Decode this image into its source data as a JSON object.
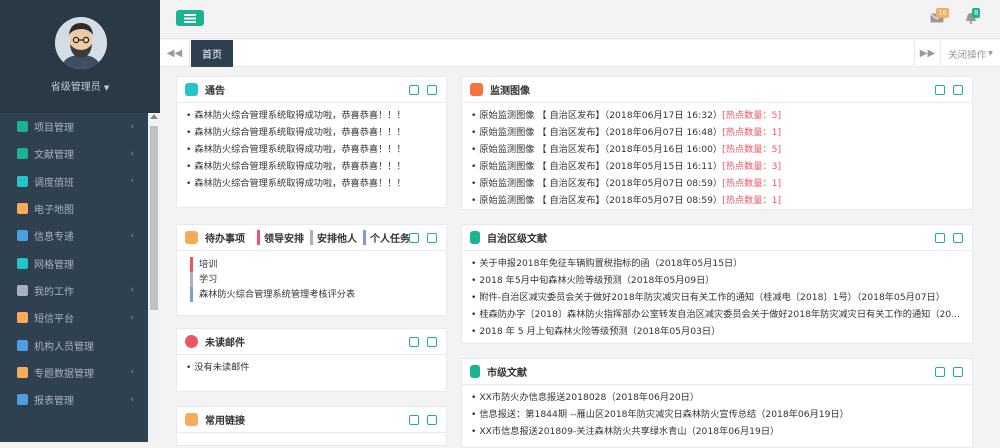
{
  "sidebar": {
    "username": "省级管理员",
    "items": [
      {
        "label": "项目管理",
        "color": "#1ab394",
        "arrow": "‹"
      },
      {
        "label": "文献管理",
        "color": "#1ab394",
        "arrow": "‹"
      },
      {
        "label": "调度值班",
        "color": "#23c6c8",
        "arrow": "‹"
      },
      {
        "label": "电子地图",
        "color": "#f8ac59",
        "arrow": ""
      },
      {
        "label": "信息专递",
        "color": "#4da0e0",
        "arrow": "‹"
      },
      {
        "label": "网格管理",
        "color": "#23c6c8",
        "arrow": ""
      },
      {
        "label": "我的工作",
        "color": "#a7b1c2",
        "arrow": "‹"
      },
      {
        "label": "短信平台",
        "color": "#f8ac59",
        "arrow": "‹"
      },
      {
        "label": "机构人员管理",
        "color": "#4da0e0",
        "arrow": ""
      },
      {
        "label": "专题数据管理",
        "color": "#f8ac59",
        "arrow": "‹"
      },
      {
        "label": "报表管理",
        "color": "#4da0e0",
        "arrow": "‹"
      }
    ]
  },
  "topbar": {
    "mail_badge": "16",
    "bell_badge": "8"
  },
  "tabs": {
    "home": "首页",
    "close_ops": "关闭操作"
  },
  "panels": {
    "notice": {
      "title": "通告",
      "items": [
        "森林防火综合管理系统取得成功啦，恭喜恭喜！！！",
        "森林防火综合管理系统取得成功啦，恭喜恭喜！！！",
        "森林防火综合管理系统取得成功啦，恭喜恭喜！！！",
        "森林防火综合管理系统取得成功啦，恭喜恭喜！！！",
        "森林防火综合管理系统取得成功啦，恭喜恭喜！！！"
      ]
    },
    "todo": {
      "title": "待办事项",
      "tabs": [
        "领导安排",
        "安排他人",
        "个人任务"
      ],
      "items": [
        "培训",
        "学习",
        "森林防火综合管理系统管理考核评分表"
      ]
    },
    "mail": {
      "title": "未读邮件",
      "items": [
        "没有未读邮件"
      ]
    },
    "links": {
      "title": "常用链接"
    },
    "monitor": {
      "title": "监测图像",
      "items": [
        {
          "text": "原始监测图像 【 自治区发布】（2018年06月17日 16:32）",
          "hot": "[热点数量：5]"
        },
        {
          "text": "原始监测图像 【 自治区发布】（2018年06月07日 16:48）",
          "hot": "[热点数量：1]"
        },
        {
          "text": "原始监测图像 【 自治区发布】（2018年05月16日 16:00）",
          "hot": "[热点数量：5]"
        },
        {
          "text": "原始监测图像 【 自治区发布】（2018年05月15日 16:11）",
          "hot": "[热点数量：3]"
        },
        {
          "text": "原始监测图像 【 自治区发布】（2018年05月07日 08:59）",
          "hot": "[热点数量：1]"
        },
        {
          "text": "原始监测图像 【 自治区发布】（2018年05月07日 08:59）",
          "hot": "[热点数量：1]"
        }
      ]
    },
    "region": {
      "title": "自治区级文献",
      "items": [
        "关于申报2018年免征车辆购置税指标的函（2018年05月15日）",
        "2018 年5月中旬森林火险等级预测（2018年05月09日）",
        "附件-自治区减灾委员会关于做好2018年防灾减灾日有关工作的通知（桂减电〔2018〕1号）（2018年05月07日）",
        "桂森防办字〔2018〕森林防火指挥部办公室转发自治区减灾委员会关于做好2018年防灾减灾日有关工作的通知（20...",
        "2018 年 5 月上旬森林火险等级预测（2018年05月03日）"
      ]
    },
    "city": {
      "title": "市级文献",
      "items": [
        "XX市防火办信息报送2018028（2018年06月20日）",
        "信息报送：第1844期 --雁山区2018年防灾减灾日森林防火宣传总结（2018年06月19日）",
        "XX市信息报送201809-关注森林防火共享绿水青山（2018年06月19日）"
      ]
    }
  }
}
